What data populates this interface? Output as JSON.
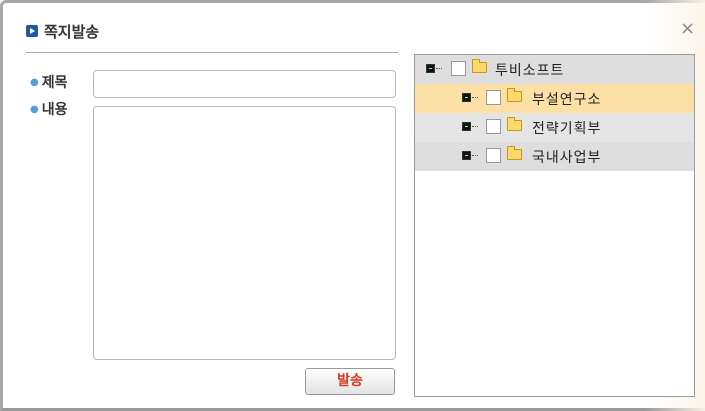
{
  "dialog": {
    "title": "쪽지발송",
    "close_glyph": "×"
  },
  "form": {
    "subject_label": "제목",
    "subject_value": "",
    "content_label": "내용",
    "content_value": "",
    "send_label": "발송"
  },
  "tree": {
    "root": {
      "label": "투비소프트",
      "checked": false,
      "expanded": true
    },
    "children": [
      {
        "label": "부설연구소",
        "checked": false,
        "selected": true
      },
      {
        "label": "전략기획부",
        "checked": false,
        "selected": false
      },
      {
        "label": "국내사업부",
        "checked": false,
        "selected": false
      }
    ]
  },
  "colors": {
    "selected_row": "#fde0a6",
    "alt_row": "#e5e5e5",
    "root_row": "#dedede",
    "send_text": "#d6371e",
    "title_icon": "#1c5a9c"
  }
}
